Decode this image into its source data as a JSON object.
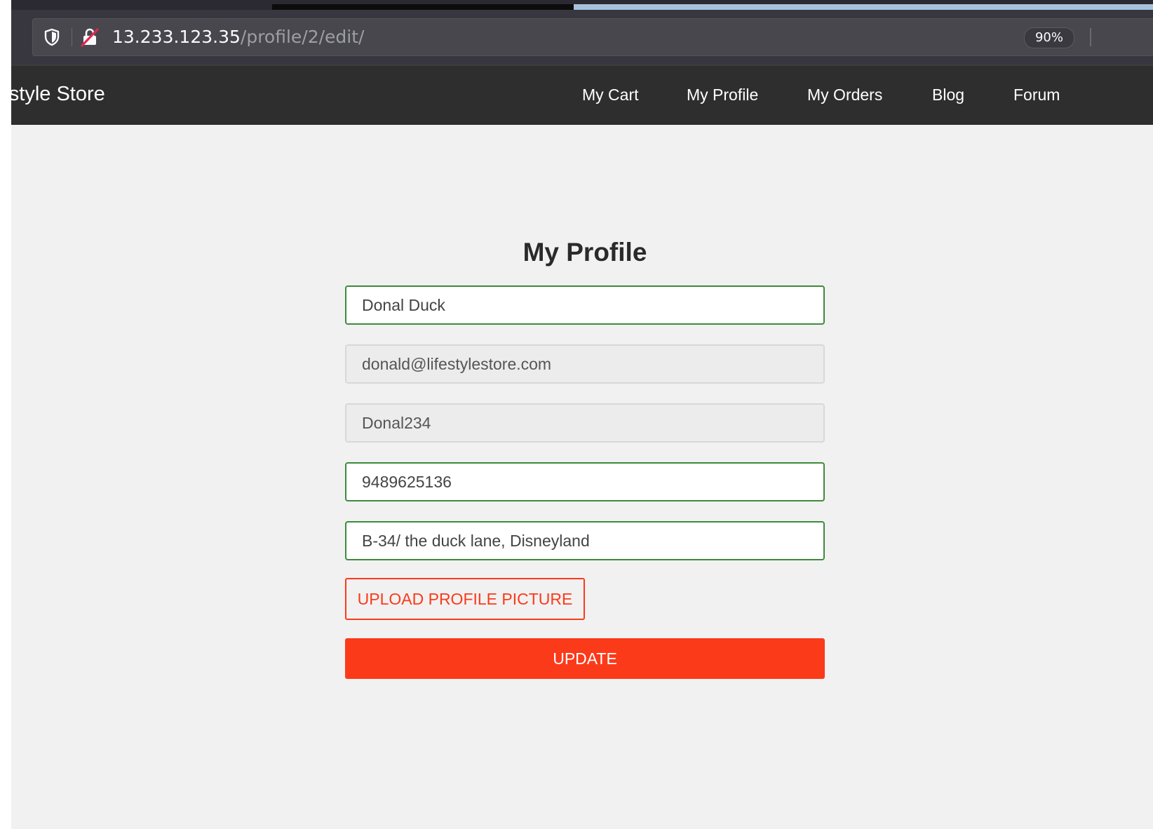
{
  "browser": {
    "url_host": "13.233.123.35",
    "url_path": "/profile/2/edit/",
    "zoom": "90%"
  },
  "navbar": {
    "brand": "Lifestyle Store",
    "links": [
      "My Cart",
      "My Profile",
      "My Orders",
      "Blog",
      "Forum"
    ]
  },
  "profile": {
    "title": "My Profile",
    "name": "Donal Duck",
    "email": "donald@lifestylestore.com",
    "username": "Donal234",
    "phone": "9489625136",
    "address": "B-34/ the duck lane, Disneyland",
    "upload_label": "UPLOAD PROFILE PICTURE",
    "update_label": "UPDATE"
  },
  "colors": {
    "accent": "#fb3a1a",
    "valid_border": "#3c8a3c",
    "navbar": "#2e2e2e",
    "page_background": "#f1f1f1"
  },
  "icons": [
    "shield-icon",
    "insecure-lock-icon"
  ]
}
